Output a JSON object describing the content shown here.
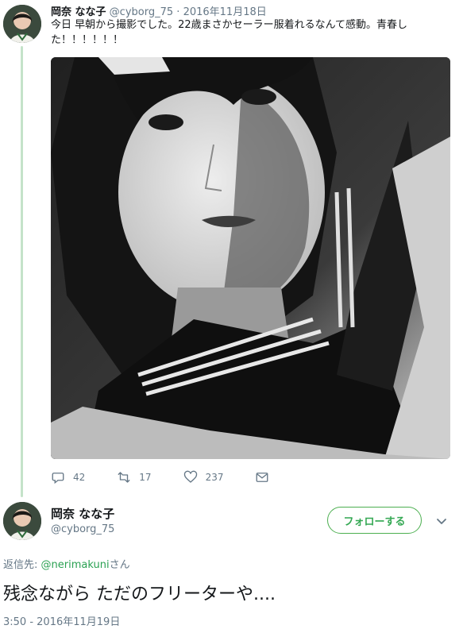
{
  "tweet1": {
    "name": "岡奈 なな子",
    "handle": "@cyborg_75",
    "separator": "·",
    "date": "2016年11月18日",
    "text": "今日 早朝から撮影でした。22歳まさかセーラー服着れるなんて感動。青春した！！！！！！",
    "actions": {
      "reply_count": "42",
      "retweet_count": "17",
      "like_count": "237"
    }
  },
  "tweet2": {
    "name": "岡奈 なな子",
    "handle": "@cyborg_75",
    "follow_label": "フォローする",
    "reply_prefix": "返信先: ",
    "reply_mention": "@nerimakuni",
    "reply_suffix": "さん",
    "text": "残念ながら ただのフリーターや....",
    "timestamp": "3:50 - 2016年11月19日"
  },
  "icons": [
    "reply-icon",
    "retweet-icon",
    "like-icon",
    "message-icon",
    "chevron-down-icon"
  ],
  "colors": {
    "thread_line": "#c4e3c9",
    "follow_accent": "#34a853",
    "mention": "#2aa152",
    "muted": "#657786"
  }
}
